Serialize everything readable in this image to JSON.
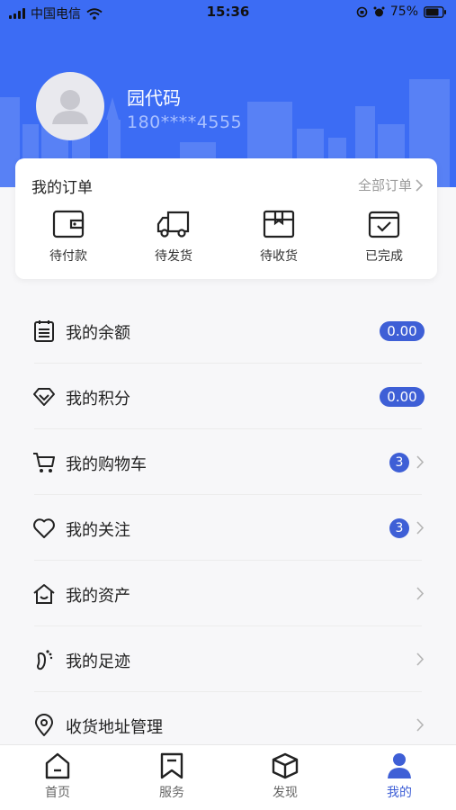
{
  "status_bar": {
    "carrier": "中国电信",
    "time": "15:36",
    "battery": "75%"
  },
  "profile": {
    "name": "园代码",
    "phone": "180****4555"
  },
  "orders": {
    "title": "我的订单",
    "all_label": "全部订单",
    "items": [
      {
        "label": "待付款",
        "icon": "wallet-icon"
      },
      {
        "label": "待发货",
        "icon": "truck-icon"
      },
      {
        "label": "待收货",
        "icon": "package-icon"
      },
      {
        "label": "已完成",
        "icon": "check-calendar-icon"
      }
    ]
  },
  "menu": [
    {
      "label": "我的余额",
      "icon": "clipboard-icon",
      "badge": "0.00"
    },
    {
      "label": "我的积分",
      "icon": "diamond-icon",
      "badge": "0.00"
    },
    {
      "label": "我的购物车",
      "icon": "cart-icon",
      "count": "3"
    },
    {
      "label": "我的关注",
      "icon": "heart-icon",
      "count": "3"
    },
    {
      "label": "我的资产",
      "icon": "house-icon"
    },
    {
      "label": "我的足迹",
      "icon": "footprint-icon"
    },
    {
      "label": "收货地址管理",
      "icon": "location-pin-icon"
    }
  ],
  "tabbar": [
    {
      "label": "首页",
      "icon": "home-icon"
    },
    {
      "label": "服务",
      "icon": "bookmark-icon"
    },
    {
      "label": "发现",
      "icon": "cube-icon"
    },
    {
      "label": "我的",
      "icon": "person-icon",
      "active": true
    }
  ],
  "colors": {
    "header": "#3c6cf4",
    "accent": "#3e5fd6",
    "background": "#f7f7f9"
  }
}
